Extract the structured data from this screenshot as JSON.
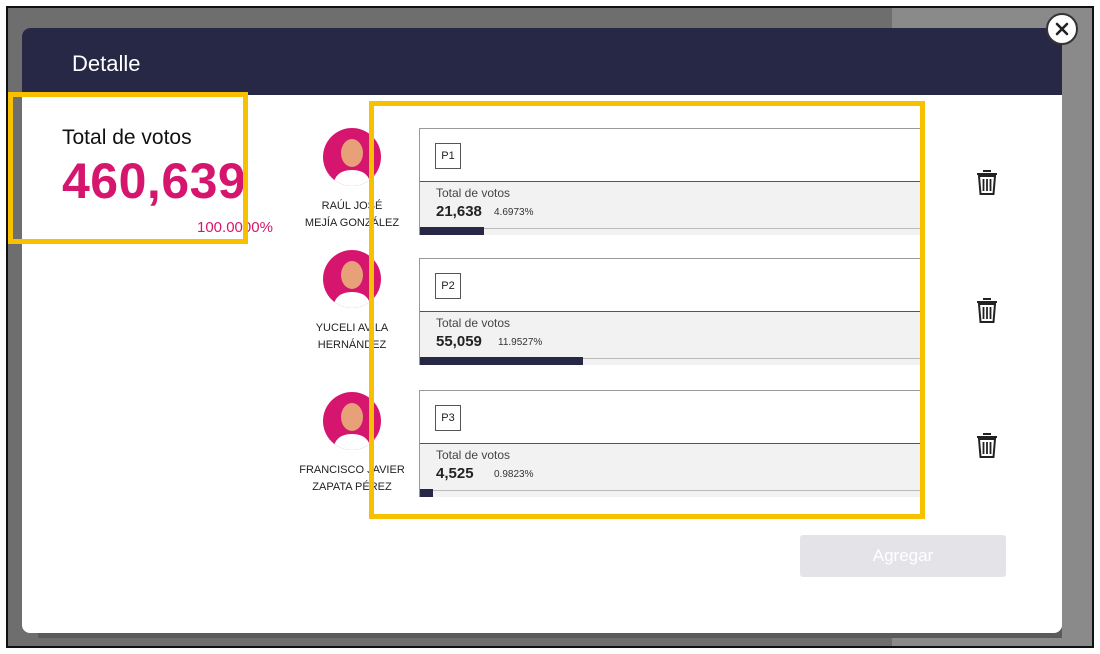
{
  "modal": {
    "title": "Detalle"
  },
  "total": {
    "label": "Total de votos",
    "value": "460,639",
    "percent": "100.0000%"
  },
  "candidates": [
    {
      "name_line1": "RAÚL JOSÉ",
      "name_line2": "MEJÍA GONZÁLEZ",
      "party": "P1",
      "votes_label": "Total de votos",
      "votes": "21,638",
      "percent": "4.6973%",
      "share": 0.046973
    },
    {
      "name_line1": "YUCELI AVILA",
      "name_line2": "HERNÁNDEZ",
      "party": "P2",
      "votes_label": "Total de votos",
      "votes": "55,059",
      "percent": "11.9527%",
      "share": 0.119527
    },
    {
      "name_line1": "FRANCISCO JAVIER",
      "name_line2": "ZAPATA PÉREZ",
      "party": "P3",
      "votes_label": "Total de votos",
      "votes": "4,525",
      "percent": "0.9823%",
      "share": 0.009823
    }
  ],
  "actions": {
    "add_label": "Agregar"
  },
  "colors": {
    "header": "#272846",
    "accent": "#d6166e",
    "highlight": "#f7c000"
  },
  "icons": {
    "close": "close-icon",
    "delete": "trash-icon",
    "avatar": "person-avatar-icon"
  }
}
